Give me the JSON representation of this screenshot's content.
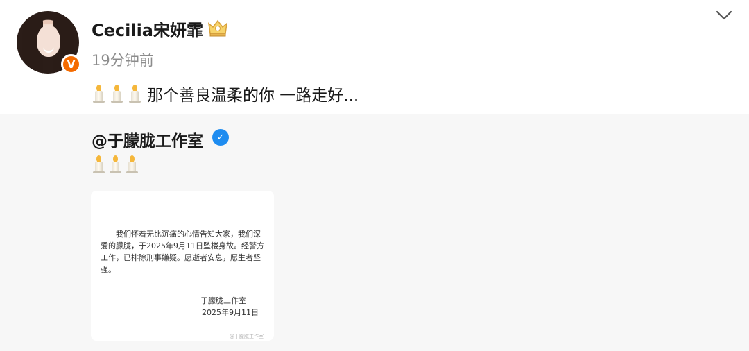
{
  "post": {
    "author": "Cecilia宋妍霏",
    "verified_badge": "V",
    "time": "19分钟前",
    "text": "那个善良温柔的你 一路走好...",
    "candles": [
      "candle-icon",
      "candle-icon",
      "candle-icon"
    ]
  },
  "repost": {
    "author": "@于朦胧工作室",
    "candles": [
      "candle-icon",
      "candle-icon",
      "candle-icon"
    ],
    "image": {
      "notice": "我们怀着无比沉痛的心情告知大家，我们深爱的朦胧，于2025年9月11日坠楼身故。经警方工作，已排除刑事嫌疑。愿逝者安息，愿生者坚强。",
      "signature": "于朦胧工作室",
      "date": "2025年9月11日",
      "watermark": "@于朦胧工作室"
    }
  },
  "colors": {
    "badge_orange": "#f46b00",
    "verified_blue": "#1e8cf0",
    "time_gray": "#8c8c8c",
    "repost_bg": "#f7f7f7"
  }
}
